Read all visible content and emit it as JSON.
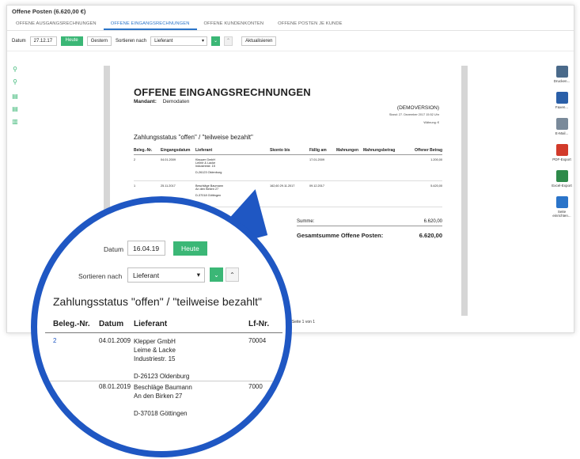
{
  "window": {
    "title": "Offene Posten (6.620,00 €)",
    "tabs": [
      "OFFENE AUSGANGSRECHNUNGEN",
      "OFFENE EINGANGSRECHNUNGEN",
      "OFFENE KUNDENKONTEN",
      "OFFENE POSTEN JE KUNDE"
    ],
    "active_tab": 1
  },
  "toolbar": {
    "datum_label": "Datum",
    "datum_value": "27.12.17",
    "heute_label": "Heute",
    "gestern_label": "Gestern",
    "sort_label": "Sortieren nach",
    "sort_value": "Lieferant",
    "aktualisieren_label": "Aktualisieren"
  },
  "report": {
    "title": "OFFENE EINGANGSRECHNUNGEN",
    "mandant_label": "Mandant:",
    "mandant_value": "Demodaten",
    "demoversion": "(DEMOVERSION)",
    "stand": "Stand: 27. Dezember 2017 15:52 Uhr",
    "waehrung": "Währung: €",
    "status_heading": "Zahlungsstatus \"offen\" / \"teilweise bezahlt\"",
    "columns": [
      "Beleg.-Nr.",
      "Eingangsdatum",
      "Lieferant",
      "Skonto bis",
      "Fällig am",
      "Mahnungen",
      "Mahnungsbetrag",
      "Offener Betrag"
    ],
    "rows": [
      {
        "nr": "2",
        "datum": "04.01.2009",
        "lieferant": [
          "Klepper GmbH",
          "Leime & Lacke",
          "Industriestr. 15",
          "",
          "D-26123 Oldenburg"
        ],
        "skonto": "",
        "faellig": "17.01.2009",
        "mahnungen": "",
        "mahnbetrag": "",
        "offen": "1.200,00"
      },
      {
        "nr": "1",
        "datum": "25.11.2017",
        "lieferant": [
          "Beschläge Baumann",
          "An den Birken 27",
          "",
          "D-37018 Göttingen"
        ],
        "skonto": "162,60  29.11.2017",
        "faellig": "09.12.2017",
        "mahnungen": "",
        "mahnbetrag": "",
        "offen": "5.420,00"
      }
    ],
    "summe_label": "Summe:",
    "summe_value": "6.620,00",
    "gesamt_label": "Gesamtsumme Offene Posten:",
    "gesamt_value": "6.620,00",
    "page_label": "1 von 1"
  },
  "pager": {
    "text": "Seite 1 von 1"
  },
  "rightbar": [
    {
      "label": "Drucken...",
      "icon": "printer-icon",
      "color": "#4a6a8a"
    },
    {
      "label": "Faxen...",
      "icon": "fax-icon",
      "color": "#2a5fa8"
    },
    {
      "label": "E-Mail...",
      "icon": "envelope-icon",
      "color": "#7a8a9a"
    },
    {
      "label": "PDF-Export",
      "icon": "pdf-icon",
      "color": "#d23a2a"
    },
    {
      "label": "Excel-Export",
      "icon": "excel-icon",
      "color": "#2e8a4a"
    },
    {
      "label": "Seite einrichten...",
      "icon": "page-setup-icon",
      "color": "#2a74c9"
    }
  ],
  "magnifier": {
    "datum_label": "Datum",
    "datum_value": "16.04.19",
    "heute_label": "Heute",
    "sort_label": "Sortieren nach",
    "sort_value": "Lieferant",
    "status_heading": "Zahlungsstatus \"offen\" / \"teilweise bezahlt\"",
    "columns": [
      "Beleg.-Nr.",
      "Datum",
      "Lieferant",
      "Lf-Nr."
    ],
    "rows": [
      {
        "nr": "2",
        "datum": "04.01.2009",
        "lieferant": [
          "Klepper GmbH",
          "Leime & Lacke",
          "Industriestr. 15",
          "",
          "D-26123 Oldenburg"
        ],
        "lfnr": "70004"
      },
      {
        "nr": "",
        "datum": "08.01.2019",
        "lieferant": [
          "Beschläge Baumann",
          "An den Birken 27",
          "",
          "D-37018 Göttingen"
        ],
        "lfnr": "7000"
      }
    ]
  },
  "colors": {
    "accent_blue": "#2a74c9",
    "button_green": "#3bb776",
    "magnifier_ring": "#1f57c3"
  }
}
